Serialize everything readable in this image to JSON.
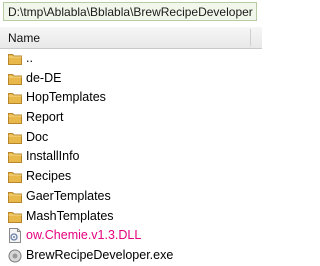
{
  "path": "D:\\tmp\\Ablabla\\Bblabla\\BrewRecipeDeveloper",
  "header": {
    "name_col": "Name"
  },
  "rows": [
    {
      "label": "..",
      "type": "folder"
    },
    {
      "label": "de-DE",
      "type": "folder"
    },
    {
      "label": "HopTemplates",
      "type": "folder"
    },
    {
      "label": "Report",
      "type": "folder"
    },
    {
      "label": "Doc",
      "type": "folder"
    },
    {
      "label": "InstallInfo",
      "type": "folder"
    },
    {
      "label": "Recipes",
      "type": "folder"
    },
    {
      "label": "GaerTemplates",
      "type": "folder"
    },
    {
      "label": "MashTemplates",
      "type": "folder"
    },
    {
      "label": "ow.Chemie.v1.3.DLL",
      "type": "dll"
    },
    {
      "label": "BrewRecipeDeveloper.exe",
      "type": "exe"
    }
  ],
  "colors": {
    "dll_text": "#e6007e",
    "folder": "#e8b84a",
    "path_bg": "#f2f7ec"
  }
}
